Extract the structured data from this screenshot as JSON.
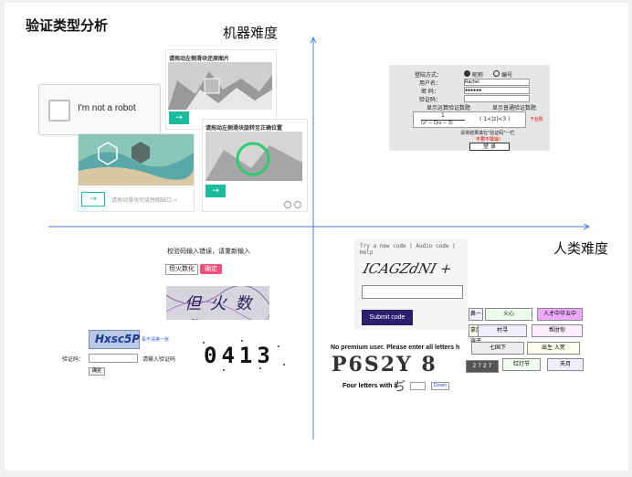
{
  "slide_title": "验证类型分析",
  "axes": {
    "y_label": "机器难度",
    "x_label": "人类难度"
  },
  "recaptcha": {
    "label": "I'm not a robot"
  },
  "slider_puzzle_1": {
    "instruction": "请拖动左侧滑块还原图片",
    "arrow": "→"
  },
  "slider_puzzle_2": {
    "arrow": "→",
    "hint": "请拖动滑块完成拼图缺口 ››"
  },
  "rotate_puzzle": {
    "instruction": "请拖动左侧滑块旋转至正确位置",
    "arrow": "→"
  },
  "form_captcha": {
    "login_method_label": "登陆方式：",
    "option_1": "昵称",
    "option_2": "编号",
    "username_label": "用户名：",
    "username_value": "Rachel",
    "password_label": "密  码：",
    "password_value": "●●●●●●",
    "captcha_label": "验证码：",
    "option_a": "显示运算验证数题",
    "option_b": "显示普通验证数题",
    "fraction_num": "1",
    "fraction_den": "(z² − D(z − 3)",
    "range_text": "( 1<|z|<3 )",
    "side_note": "下台阶",
    "instruction": "请将结果填在\"验证码\"一栏",
    "instruction_red": "不要不敢输！",
    "login_button": "登  录"
  },
  "chinese_captcha": {
    "error_text": "校验码输入错误，请重新输入",
    "input_value": "但火数化",
    "confirm_button": "确定",
    "image_text": "但 火 数 化"
  },
  "hxsc_captcha": {
    "image_text": "Hxsc5P",
    "refresh_text": "看不清换一张",
    "label": "验证码：",
    "placeholder_text": "请输入验证码",
    "submit_button": "确定"
  },
  "digits_captcha": {
    "text": "0413"
  },
  "recaptcha_text": {
    "links": "Try a new code | Audio code | Help",
    "distorted_text": "ICAGZdNI +",
    "submit_button": "Submit code"
  },
  "premium_captcha": {
    "heading": "No premium user. Please enter all letters h",
    "image_text": "P6S2Y 8",
    "prompt": "Four letters with a",
    "glyph": "ぢ",
    "button": "Down"
  },
  "cn_grid": {
    "cells": [
      "鼻一",
      "火心",
      "人才中华五中",
      "拿面容子",
      "村寻",
      "帮肘你",
      "七国下",
      "出生 入死",
      "2 7 2 7",
      "红灯节",
      "天月"
    ]
  },
  "colors": {
    "axis": "#4a7fd4",
    "slider_green": "#1abc9c",
    "submit_purple": "#2a1e6e",
    "confirm_pink": "#f0507c"
  }
}
